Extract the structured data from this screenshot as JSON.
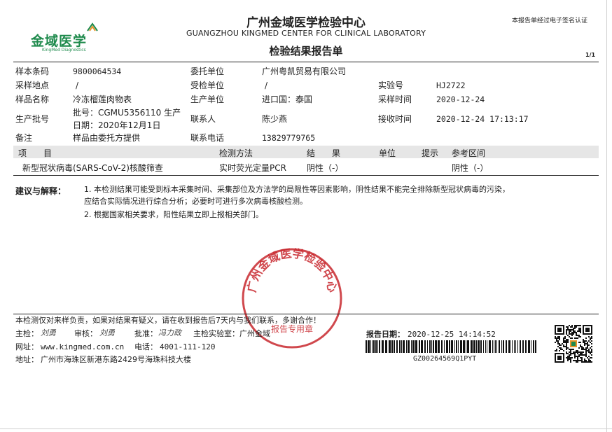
{
  "header": {
    "logo_cn": "金域医学",
    "logo_en": "KingMed Diagnostics",
    "title_cn": "广州金域医学检验中心",
    "title_en": "GUANGZHOU KINGMED CENTER FOR CLINICAL LABORATORY",
    "report_title": "检验结果报告单",
    "signature_note": "本报告单经过电子签名认证",
    "page": "1/1"
  },
  "info": {
    "sample_code_label": "样本条码",
    "sample_code": "9800064534",
    "client_label": "委托单位",
    "client": "广州粤凯贸易有限公司",
    "collect_place_label": "采样地点",
    "collect_place": "/",
    "recv_unit_label": "受检单位",
    "recv_unit": "/",
    "lab_no_label": "实验号",
    "lab_no": "HJ2722",
    "sample_name_label": "样品名称",
    "sample_name": "冷冻榴莲肉物表",
    "maker_label": "生产单位",
    "maker": "进口国：泰国",
    "collect_time_label": "采样时间",
    "collect_time": "2020-12-24",
    "batch_label": "生产批号",
    "batch_line1": "批号：CGMU5356110 生产",
    "batch_line2": "日期：2020年12月1日",
    "contact_label": "联系人",
    "contact": "陈少燕",
    "recv_time_label": "接收时间",
    "recv_time": "2020-12-24 17:13:17",
    "note_label": "备注",
    "note": "样品由委托方提供",
    "phone_label": "联系电话",
    "phone": "13829779765"
  },
  "table": {
    "headers": {
      "item": "项　　目",
      "method": "检测方法",
      "result": "结　　果",
      "unit": "单位",
      "hint": "提示",
      "ref": "参考区间"
    },
    "row": {
      "item": "新型冠状病毒(SARS-CoV-2)核酸筛查",
      "method": "实时荧光定量PCR",
      "result": "阴性（-）",
      "unit": "",
      "hint": "",
      "ref": "阴性（-）"
    }
  },
  "advice": {
    "label": "建议与解释：",
    "line1": "1. 本检测结果可能受到标本采集时间、采集部位及方法学的局限性等因素影响，阴性结果不能完全排除新型冠状病毒的污染，",
    "line2": "应结合实际情况进行综合分析；必要时可进行多次病毒核酸检测。",
    "line3": "2. 根据国家相关要求，阳性结果立即上报相关部门。"
  },
  "stamp": {
    "text": "广州金域医学检验中心",
    "sub": "报告专用章"
  },
  "footer": {
    "disclaimer": "本检测仅对来样负责，如果对结果有疑义，请在收到报告后7天内与我们联系，多谢合作！",
    "main_check_label": "主检：",
    "main_check_sign": "刘勇",
    "review_label": "审核：",
    "review_sign": "刘勇",
    "approve_label": "批准：",
    "approve_sign": "冯力政",
    "lab_label": "主检实验室：广州金域",
    "web_label": "网址：",
    "web": "www.kingmed.com.cn",
    "tel_label": "电话：",
    "tel": "4001-111-120",
    "addr_label": "地址：",
    "addr": "广州市海珠区新港东路2429号海珠科技大楼",
    "report_date_label": "报告日期：",
    "report_date": "2020-12-25 14:14:52",
    "barcode_text": "GZ00264569Q1PYT"
  },
  "colors": {
    "brand_green": "#1e8a4c",
    "brand_orange": "#e8942a",
    "stamp_red": "#c8282e"
  }
}
